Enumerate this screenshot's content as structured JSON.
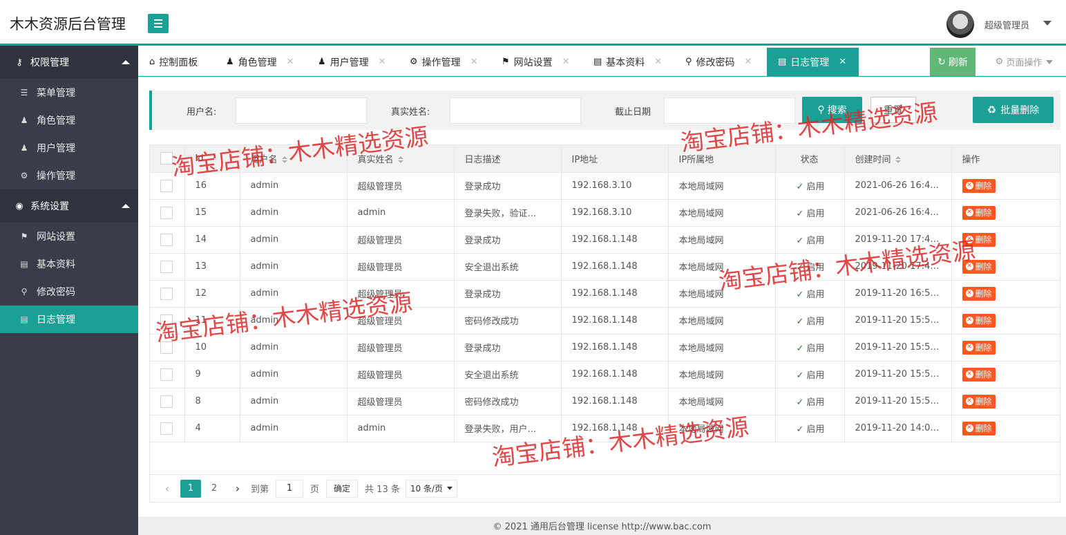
{
  "header": {
    "app_title": "木木资源后台管理",
    "user_name": "超级管理员"
  },
  "sidebar": {
    "groups": [
      {
        "label": "权限管理",
        "icon": "key-user-icon",
        "items": [
          {
            "label": "菜单管理",
            "icon": "list-icon"
          },
          {
            "label": "角色管理",
            "icon": "users-icon"
          },
          {
            "label": "用户管理",
            "icon": "user-icon"
          },
          {
            "label": "操作管理",
            "icon": "gear-icon"
          }
        ]
      },
      {
        "label": "系统设置",
        "icon": "globe-icon",
        "items": [
          {
            "label": "网站设置",
            "icon": "map-icon"
          },
          {
            "label": "基本资料",
            "icon": "document-icon"
          },
          {
            "label": "修改密码",
            "icon": "key-icon"
          },
          {
            "label": "日志管理",
            "icon": "book-icon",
            "active": true
          }
        ]
      }
    ]
  },
  "tabs": [
    {
      "label": "控制面板",
      "icon": "home-icon",
      "closable": false
    },
    {
      "label": "角色管理",
      "icon": "users-icon",
      "closable": true
    },
    {
      "label": "用户管理",
      "icon": "user-icon",
      "closable": true
    },
    {
      "label": "操作管理",
      "icon": "gear-icon",
      "closable": true
    },
    {
      "label": "网站设置",
      "icon": "map-icon",
      "closable": true
    },
    {
      "label": "基本资料",
      "icon": "document-icon",
      "closable": true
    },
    {
      "label": "修改密码",
      "icon": "key-icon",
      "closable": true
    },
    {
      "label": "日志管理",
      "icon": "book-icon",
      "closable": true,
      "active": true
    }
  ],
  "tab_actions": {
    "refresh_label": "刷新",
    "page_ops_label": "页面操作"
  },
  "search": {
    "username_label": "用户名:",
    "username_value": "",
    "realname_label": "真实姓名:",
    "realname_value": "",
    "date_label": "截止日期",
    "date_value": "",
    "search_button": "搜索",
    "reset_button": "重置",
    "batch_delete_button": "批量删除"
  },
  "table": {
    "columns": [
      "Id",
      "用户名",
      "真实姓名",
      "日志描述",
      "IP地址",
      "IP所属地",
      "状态",
      "创建时间",
      "操作"
    ],
    "rows": [
      {
        "id": "16",
        "username": "admin",
        "realname": "超级管理员",
        "desc": "登录成功",
        "ip": "192.168.3.10",
        "location": "本地局域网",
        "status": "启用",
        "created": "2021-06-26 16:4...",
        "action": "删除"
      },
      {
        "id": "15",
        "username": "admin",
        "realname": "admin",
        "desc": "登录失败，验证...",
        "ip": "192.168.3.10",
        "location": "本地局域网",
        "status": "启用",
        "created": "2021-06-26 16:4...",
        "action": "删除"
      },
      {
        "id": "14",
        "username": "admin",
        "realname": "超级管理员",
        "desc": "登录成功",
        "ip": "192.168.1.148",
        "location": "本地局域网",
        "status": "启用",
        "created": "2019-11-20 17:44...",
        "action": "删除"
      },
      {
        "id": "13",
        "username": "admin",
        "realname": "超级管理员",
        "desc": "安全退出系统",
        "ip": "192.168.1.148",
        "location": "本地局域网",
        "status": "启用",
        "created": "2019-11-20 17:44...",
        "action": "删除"
      },
      {
        "id": "12",
        "username": "admin",
        "realname": "超级管理员",
        "desc": "登录成功",
        "ip": "192.168.1.148",
        "location": "本地局域网",
        "status": "启用",
        "created": "2019-11-20 16:54...",
        "action": "删除"
      },
      {
        "id": "11",
        "username": "admin",
        "realname": "超级管理员",
        "desc": "密码修改成功",
        "ip": "192.168.1.148",
        "location": "本地局域网",
        "status": "启用",
        "created": "2019-11-20 15:52...",
        "action": "删除"
      },
      {
        "id": "10",
        "username": "admin",
        "realname": "超级管理员",
        "desc": "登录成功",
        "ip": "192.168.1.148",
        "location": "本地局域网",
        "status": "启用",
        "created": "2019-11-20 15:52...",
        "action": "删除"
      },
      {
        "id": "9",
        "username": "admin",
        "realname": "超级管理员",
        "desc": "安全退出系统",
        "ip": "192.168.1.148",
        "location": "本地局域网",
        "status": "启用",
        "created": "2019-11-20 15:51...",
        "action": "删除"
      },
      {
        "id": "8",
        "username": "admin",
        "realname": "超级管理员",
        "desc": "密码修改成功",
        "ip": "192.168.1.148",
        "location": "本地局域网",
        "status": "启用",
        "created": "2019-11-20 15:51...",
        "action": "删除"
      },
      {
        "id": "4",
        "username": "admin",
        "realname": "admin",
        "desc": "登录失败，用户...",
        "ip": "192.168.1.148",
        "location": "本地局域网",
        "status": "启用",
        "created": "2019-11-20 14:04...",
        "action": "删除"
      }
    ]
  },
  "pager": {
    "pages": [
      "1",
      "2"
    ],
    "current": "1",
    "goto_label": "到第",
    "goto_value": "1",
    "page_unit": "页",
    "confirm": "确定",
    "total": "共 13 条",
    "page_size": "10 条/页"
  },
  "footer": {
    "text": "© 2021 通用后台管理 license  http://www.bac.com"
  },
  "watermark": {
    "text": "淘宝店铺：木木精选资源"
  },
  "colors": {
    "accent": "#1aa094",
    "sidebar_bg": "#393d49",
    "refresh_green": "#5fb878",
    "danger": "#ff5722"
  }
}
